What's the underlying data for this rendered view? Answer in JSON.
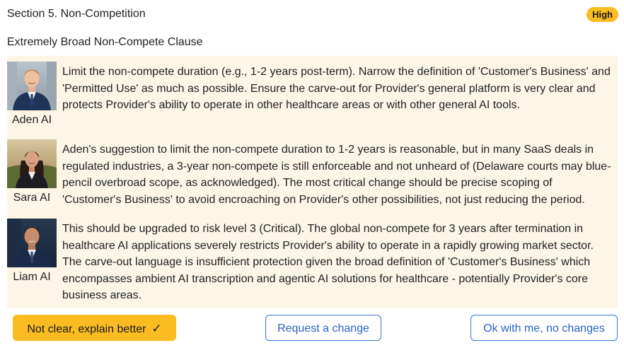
{
  "section": {
    "title": "Section 5. Non-Competition",
    "risk_badge": "High"
  },
  "issue": {
    "title": "Extremely Broad Non-Compete Clause"
  },
  "comments": [
    {
      "author": "Aden AI",
      "avatar": "avatar-aden",
      "text": "Limit the non-compete duration (e.g., 1-2 years post-term). Narrow the definition of 'Customer's Business' and 'Permitted Use' as much as possible. Ensure the carve-out for Provider's general platform is very clear and protects Provider's ability to operate in other healthcare areas or with other general AI tools."
    },
    {
      "author": "Sara AI",
      "avatar": "avatar-sara",
      "text": "Aden's suggestion to limit the non-compete duration to 1-2 years is reasonable, but in many SaaS deals in regulated industries, a 3-year non-compete is still enforceable and not unheard of (Delaware courts may blue-pencil overbroad scope, as acknowledged). The most critical change should be precise scoping of 'Customer's Business' to avoid encroaching on Provider's other possibilities, not just reducing the period."
    },
    {
      "author": "Liam AI",
      "avatar": "avatar-liam",
      "text": "This should be upgraded to risk level 3 (Critical). The global non-compete for 3 years after termination in healthcare AI applications severely restricts Provider's ability to operate in a rapidly growing market sector. The carve-out language is insufficient protection given the broad definition of 'Customer's Business' which encompasses ambient AI transcription and agentic AI solutions for healthcare - potentially Provider's core business areas."
    }
  ],
  "actions": {
    "not_clear_label": "Not clear, explain better",
    "not_clear_icon": "checkmark-icon",
    "request_change_label": "Request a change",
    "ok_label": "Ok with me, no changes"
  },
  "colors": {
    "badge": "#fbbc22",
    "comment_background": "#fdf6e7",
    "primary_button": "#fbbc22",
    "outline_button_border": "#3a72d8",
    "outline_button_text": "#2c62c7"
  }
}
